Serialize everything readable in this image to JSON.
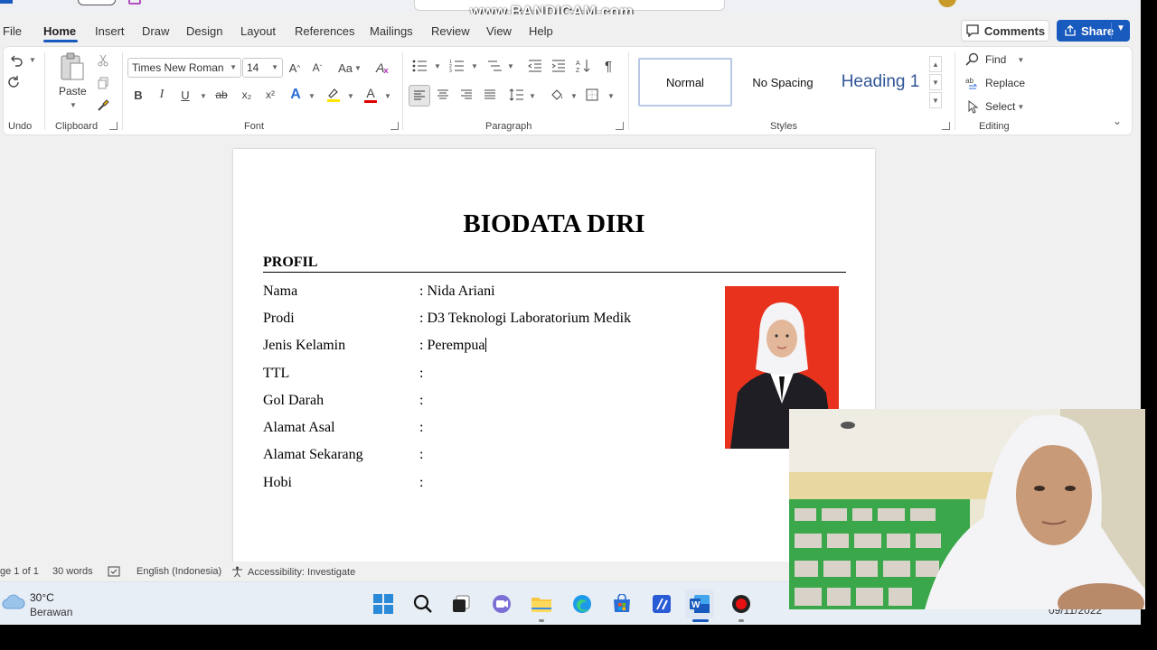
{
  "watermark": "www.BANDICAM.com",
  "menu": {
    "items": [
      "File",
      "Home",
      "Insert",
      "Draw",
      "Design",
      "Layout",
      "References",
      "Mailings",
      "Review",
      "View",
      "Help"
    ],
    "active": "Home"
  },
  "actions": {
    "comments": "Comments",
    "share": "Share"
  },
  "ribbon": {
    "groups": {
      "undo": "Undo",
      "clipboard": "Clipboard",
      "font": "Font",
      "paragraph": "Paragraph",
      "styles": "Styles",
      "editing": "Editing"
    },
    "paste_label": "Paste",
    "font_name": "Times New Roman",
    "font_size": "14",
    "styles_list": [
      "Normal",
      "No Spacing",
      "Heading 1"
    ],
    "editing": {
      "find": "Find",
      "replace": "Replace",
      "select": "Select"
    },
    "glyphs": {
      "grow": "A^",
      "shrink": "A˅",
      "case": "Aa",
      "bold": "B",
      "italic": "I",
      "underline": "U",
      "strike": "ab",
      "subscript": "x₂",
      "superscript": "x²",
      "text_effects": "A",
      "font_color": "A",
      "pilcrow": "¶"
    }
  },
  "document": {
    "title": "BIODATA DIRI",
    "section": "PROFIL",
    "fields": [
      {
        "label": "Nama",
        "value": ": Nida Ariani"
      },
      {
        "label": "Prodi",
        "value": ": D3 Teknologi Laboratorium Medik"
      },
      {
        "label": "Jenis Kelamin",
        "value": ": Perempua"
      },
      {
        "label": "TTL",
        "value": ":"
      },
      {
        "label": "Gol Darah",
        "value": ":"
      },
      {
        "label": "Alamat Asal",
        "value": ":"
      },
      {
        "label": "Alamat Sekarang",
        "value": ":"
      },
      {
        "label": "Hobi",
        "value": ":"
      }
    ]
  },
  "status": {
    "page": "ge 1 of 1",
    "words": "30 words",
    "language": "English (Indonesia)",
    "accessibility": "Accessibility: Investigate"
  },
  "taskbar": {
    "weather_temp": "30°C",
    "weather_desc": "Berawan",
    "date": "09/11/2022"
  }
}
